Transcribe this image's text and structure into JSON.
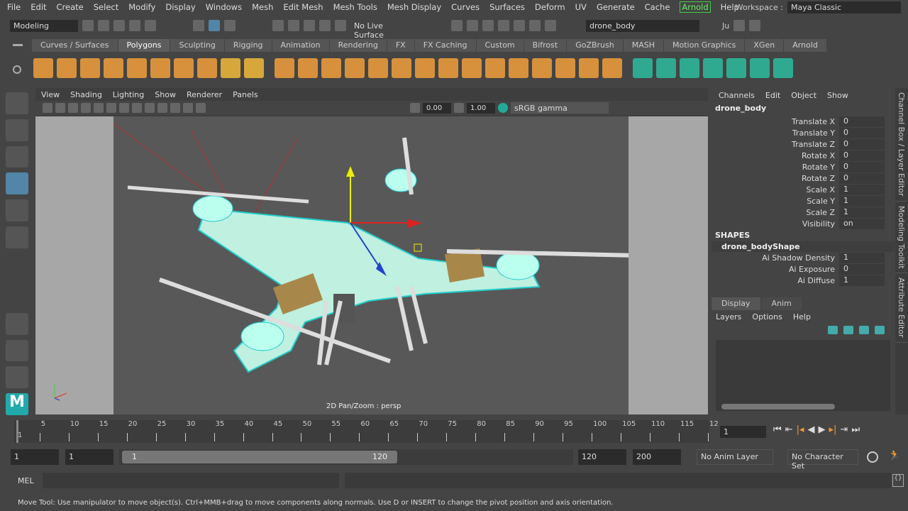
{
  "menubar": {
    "items": [
      "File",
      "Edit",
      "Create",
      "Select",
      "Modify",
      "Display",
      "Windows",
      "Mesh",
      "Edit Mesh",
      "Mesh Tools",
      "Mesh Display",
      "Curves",
      "Surfaces",
      "Deform",
      "UV",
      "Generate",
      "Cache",
      "Arnold",
      "Help"
    ],
    "workspace_label": "Workspace :",
    "workspace_value": "Maya Classic"
  },
  "statusline": {
    "mode": "Modeling",
    "live_surface": "No Live Surface",
    "object_name": "drone_body",
    "user": "Ju"
  },
  "shelf": {
    "tabs": [
      "Curves / Surfaces",
      "Polygons",
      "Sculpting",
      "Rigging",
      "Animation",
      "Rendering",
      "FX",
      "FX Caching",
      "Custom",
      "Bifrost",
      "GoZBrush",
      "MASH",
      "Motion Graphics",
      "XGen",
      "Arnold"
    ],
    "active": "Polygons"
  },
  "viewport": {
    "menus": [
      "View",
      "Shading",
      "Lighting",
      "Show",
      "Renderer",
      "Panels"
    ],
    "exposure": "0.00",
    "gamma": "1.00",
    "color_space": "sRGB gamma",
    "hud_label": "2D Pan/Zoom : persp"
  },
  "channelbox": {
    "menus": [
      "Channels",
      "Edit",
      "Object",
      "Show"
    ],
    "object": "drone_body",
    "channels": [
      {
        "label": "Translate X",
        "value": "0"
      },
      {
        "label": "Translate Y",
        "value": "0"
      },
      {
        "label": "Translate Z",
        "value": "0"
      },
      {
        "label": "Rotate X",
        "value": "0"
      },
      {
        "label": "Rotate Y",
        "value": "0"
      },
      {
        "label": "Rotate Z",
        "value": "0"
      },
      {
        "label": "Scale X",
        "value": "1"
      },
      {
        "label": "Scale Y",
        "value": "1"
      },
      {
        "label": "Scale Z",
        "value": "1"
      },
      {
        "label": "Visibility",
        "value": "on"
      }
    ],
    "shapes_label": "SHAPES",
    "shape_name": "drone_bodyShape",
    "shape_channels": [
      {
        "label": "Ai Shadow Density",
        "value": "1"
      },
      {
        "label": "Ai Exposure",
        "value": "0"
      },
      {
        "label": "Ai Diffuse",
        "value": "1"
      }
    ]
  },
  "layer_editor": {
    "tabs": [
      "Display",
      "Anim"
    ],
    "menus": [
      "Layers",
      "Options",
      "Help"
    ]
  },
  "side_tabs": [
    "Channel Box / Layer Editor",
    "Modeling Toolkit",
    "Attribute Editor"
  ],
  "timeline": {
    "ticks": [
      "1",
      "5",
      "10",
      "15",
      "20",
      "25",
      "30",
      "35",
      "40",
      "45",
      "50",
      "55",
      "60",
      "65",
      "70",
      "75",
      "80",
      "85",
      "90",
      "95",
      "100",
      "105",
      "110",
      "115",
      "12"
    ],
    "current_frame": "1"
  },
  "range": {
    "start": "1",
    "playback_start": "1",
    "slider_start": "1",
    "slider_end": "120",
    "playback_end": "120",
    "end": "200",
    "anim_layer": "No Anim Layer",
    "char_set": "No Character Set"
  },
  "cmdline": {
    "label": "MEL"
  },
  "helpline": "Move Tool: Use manipulator to move object(s). Ctrl+MMB+drag to move components along normals. Use D or INSERT to change the pivot position and axis orientation."
}
